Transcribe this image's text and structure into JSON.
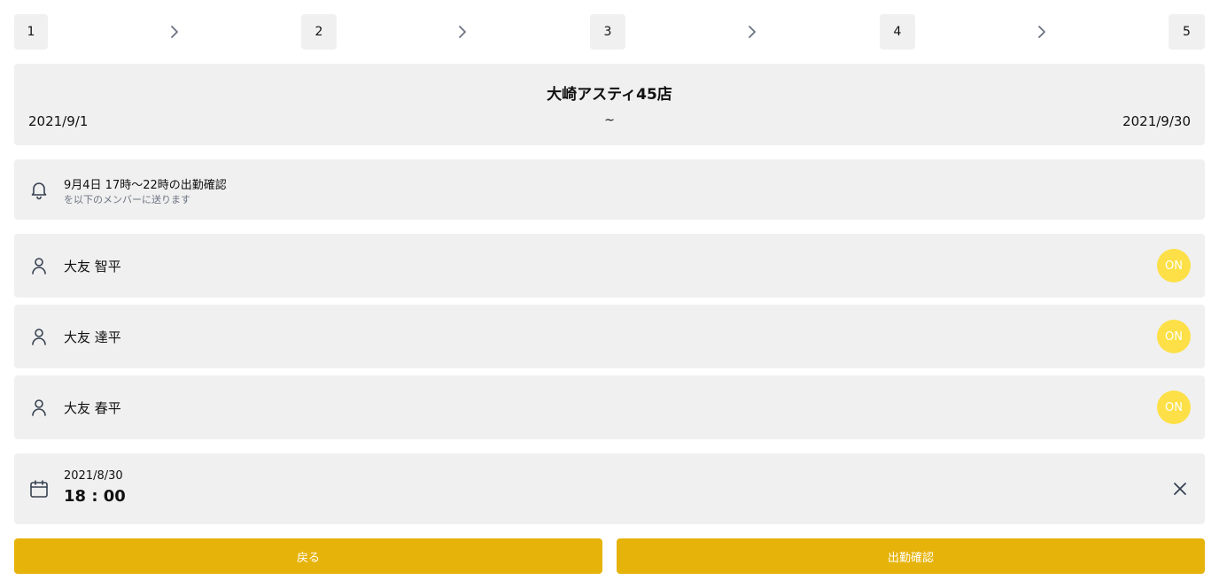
{
  "stepper": {
    "steps": [
      "1",
      "2",
      "3",
      "4",
      "5"
    ],
    "separator_icon": "chevron-right-icon"
  },
  "store": {
    "name": "大崎アスティ45店",
    "period_start": "2021/9/1",
    "period_separator": "~",
    "period_end": "2021/9/30"
  },
  "notice": {
    "icon": "bell-icon",
    "main": "9月4日 17時〜22時の出勤確認",
    "sub": "を以下のメンバーに送ります"
  },
  "members": [
    {
      "icon": "user-icon",
      "name": "大友 智平",
      "toggle": "ON"
    },
    {
      "icon": "user-icon",
      "name": "大友 達平",
      "toggle": "ON"
    },
    {
      "icon": "user-icon",
      "name": "大友 春平",
      "toggle": "ON"
    }
  ],
  "datetime": {
    "icon": "calendar-icon",
    "date": "2021/8/30",
    "time": "18 : 00",
    "clear_icon": "close-icon"
  },
  "actions": {
    "back_label": "戻る",
    "confirm_label": "出勤確認"
  },
  "colors": {
    "card_bg": "#f0f0f0",
    "toggle_on": "#fde047",
    "primary_button": "#e6b30a"
  }
}
